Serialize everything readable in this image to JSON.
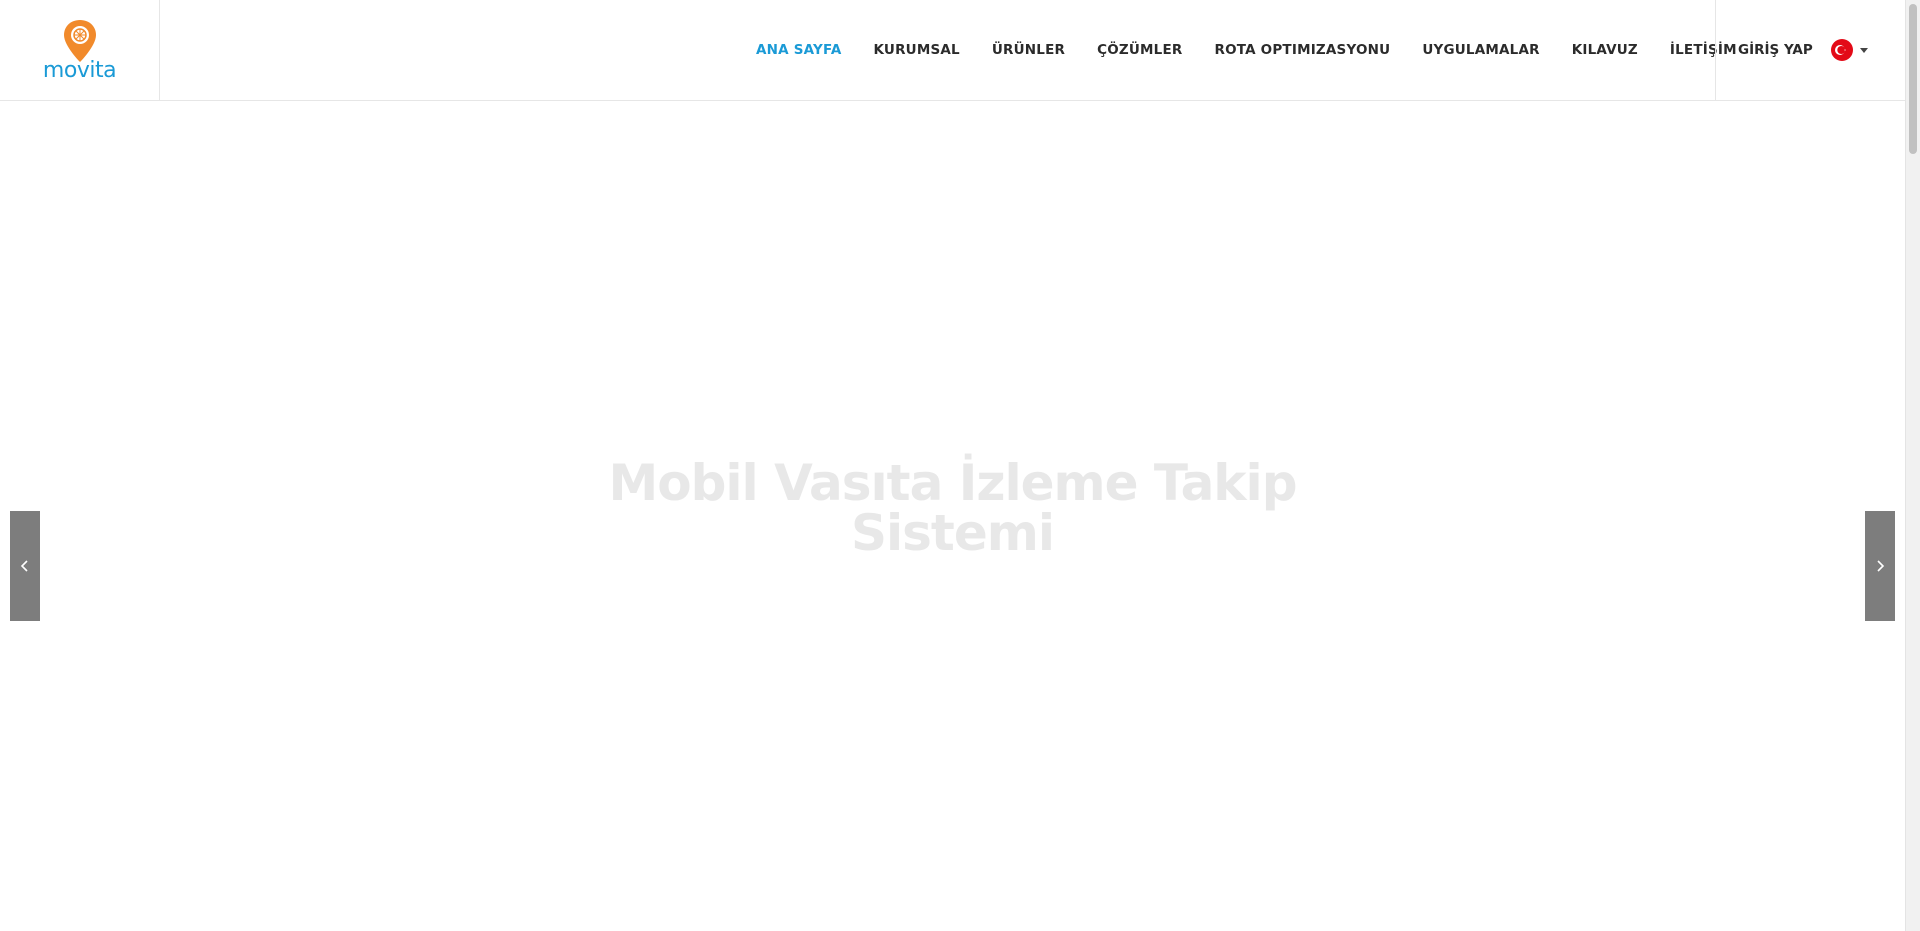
{
  "brand": {
    "name": "movita",
    "pin_color": "#f18a2b",
    "text_color": "#1a9ad6"
  },
  "nav": {
    "items": [
      {
        "label": "ANA SAYFA",
        "active": true
      },
      {
        "label": "KURUMSAL",
        "active": false
      },
      {
        "label": "ÜRÜNLER",
        "active": false
      },
      {
        "label": "ÇÖZÜMLER",
        "active": false
      },
      {
        "label": "ROTA OPTIMIZASYONU",
        "active": false
      },
      {
        "label": "UYGULAMALAR",
        "active": false
      },
      {
        "label": "KILAVUZ",
        "active": false
      },
      {
        "label": "İLETİŞİM",
        "active": false
      }
    ],
    "active_color": "#1a9ad6"
  },
  "header": {
    "login_label": "GİRİŞ YAP",
    "language_icon": "turkey-flag-icon"
  },
  "slider": {
    "title_line1": "Mobil Vasıta İzleme Takip",
    "title_line2": "Sistemi",
    "prev_icon": "chevron-left-icon",
    "next_icon": "chevron-right-icon"
  }
}
